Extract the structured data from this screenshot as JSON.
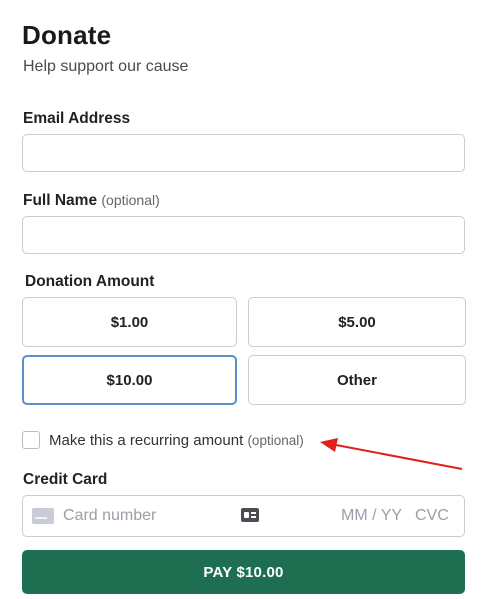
{
  "header": {
    "title": "Donate",
    "subtitle": "Help support our cause"
  },
  "form": {
    "email_label": "Email Address",
    "email_value": "",
    "name_label": "Full Name",
    "name_optional": "(optional)",
    "name_value": "",
    "amount_label": "Donation Amount",
    "amounts": [
      {
        "label": "$1.00",
        "selected": false
      },
      {
        "label": "$5.00",
        "selected": false
      },
      {
        "label": "$10.00",
        "selected": true
      },
      {
        "label": "Other",
        "selected": false
      }
    ],
    "recurring_label": "Make this a recurring amount",
    "recurring_optional": "(optional)",
    "recurring_checked": false,
    "card_label": "Credit Card",
    "card_number_placeholder": "Card number",
    "card_expiry_placeholder": "MM / YY",
    "card_cvc_placeholder": "CVC",
    "pay_label": "PAY $10.00"
  },
  "annotation": {
    "arrow_color": "#e0201b"
  },
  "colors": {
    "pay_button": "#1e6f52",
    "selected_border": "#5b8fc7"
  }
}
